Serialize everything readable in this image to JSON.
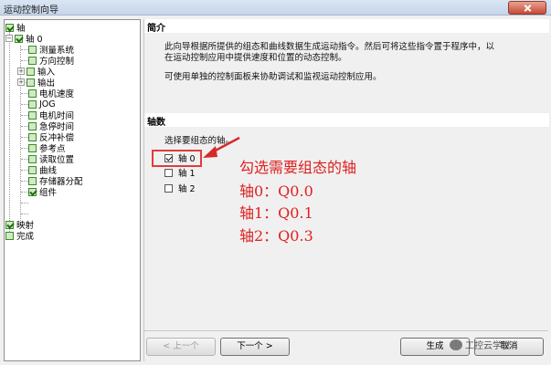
{
  "window": {
    "title": "运动控制向导"
  },
  "tree": {
    "items": [
      {
        "label": "轴",
        "checked": true
      },
      {
        "label": "轴 0",
        "checked": true
      },
      {
        "label": "测量系统"
      },
      {
        "label": "方向控制"
      },
      {
        "label": "输入"
      },
      {
        "label": "输出"
      },
      {
        "label": "电机速度"
      },
      {
        "label": "JOG"
      },
      {
        "label": "电机时间"
      },
      {
        "label": "急停时间"
      },
      {
        "label": "反冲补偿"
      },
      {
        "label": "参考点"
      },
      {
        "label": "读取位置"
      },
      {
        "label": "曲线"
      },
      {
        "label": "存储器分配"
      },
      {
        "label": "组件",
        "checked": true
      },
      {
        "label": "映射",
        "checked": true
      },
      {
        "label": "完成"
      }
    ]
  },
  "intro": {
    "title": "简介",
    "line1": "此向导根据所提供的组态和曲线数据生成运动指令。然后可将这些指令置于程序中，以",
    "line2": "在运动控制应用中提供速度和位置的动态控制。",
    "line3": "可使用单独的控制面板来协助调试和监视运动控制应用。"
  },
  "axes": {
    "title": "轴数",
    "prompt": "选择要组态的轴。",
    "options": [
      {
        "label": "轴 0",
        "checked": true
      },
      {
        "label": "轴 1",
        "checked": false
      },
      {
        "label": "轴 2",
        "checked": false
      }
    ]
  },
  "annotation": {
    "line1": "勾选需要组态的轴",
    "line2": "轴0：Q0.0",
    "line3": "轴1：Q0.1",
    "line4": "轴2：Q0.3",
    "color": "#e02020"
  },
  "buttons": {
    "prev": "< 上一个",
    "next": "下一个 >",
    "generate": "生成",
    "cancel": "取消"
  },
  "watermark": "工控云学堂"
}
